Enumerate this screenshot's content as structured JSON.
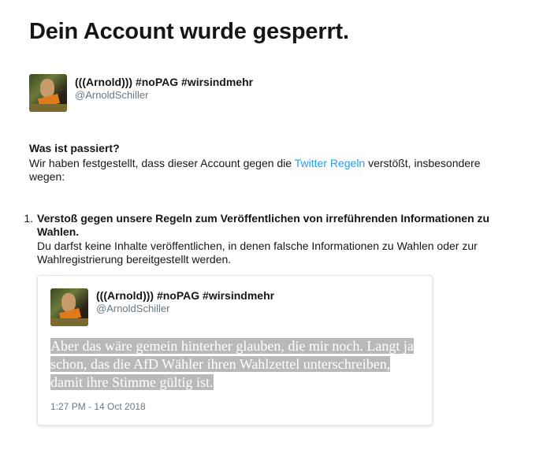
{
  "page": {
    "title": "Dein Account wurde gesperrt."
  },
  "account": {
    "display_name": "(((Arnold))) #noPAG #wirsindmehr",
    "handle": "@ArnoldSchiller",
    "avatar_icon": "profile-photo-avatar"
  },
  "notice": {
    "heading": "Was ist passiert?",
    "intro_before": "Wir haben festgestellt, dass dieser Account gegen die ",
    "intro_link": "Twitter Regeln",
    "intro_after": " verstößt, insbesondere wegen:"
  },
  "violations": [
    {
      "number": "1.",
      "title": "Verstoß gegen unsere Regeln zum Veröffentlichen von irreführenden Informationen zu Wahlen.",
      "description": "Du darfst keine Inhalte veröffentlichen, in denen falsche Informationen zu Wahlen oder zur Wahlregistrierung bereitgestellt werden."
    }
  ],
  "tweet": {
    "display_name": "(((Arnold))) #noPAG #wirsindmehr",
    "handle": "@ArnoldSchiller",
    "text": "Aber das wäre gemein hinterher glauben, die mir noch. Langt ja schon, das die AfD Wähler ihren Wahlzettel unterschreiben, damit ihre Stimme gültig ist.",
    "timestamp": "1:27 PM - 14 Oct 2018"
  },
  "colors": {
    "link": "#1da1f2",
    "secondary_text": "#657786",
    "text_highlight": "#b9b9b9"
  }
}
